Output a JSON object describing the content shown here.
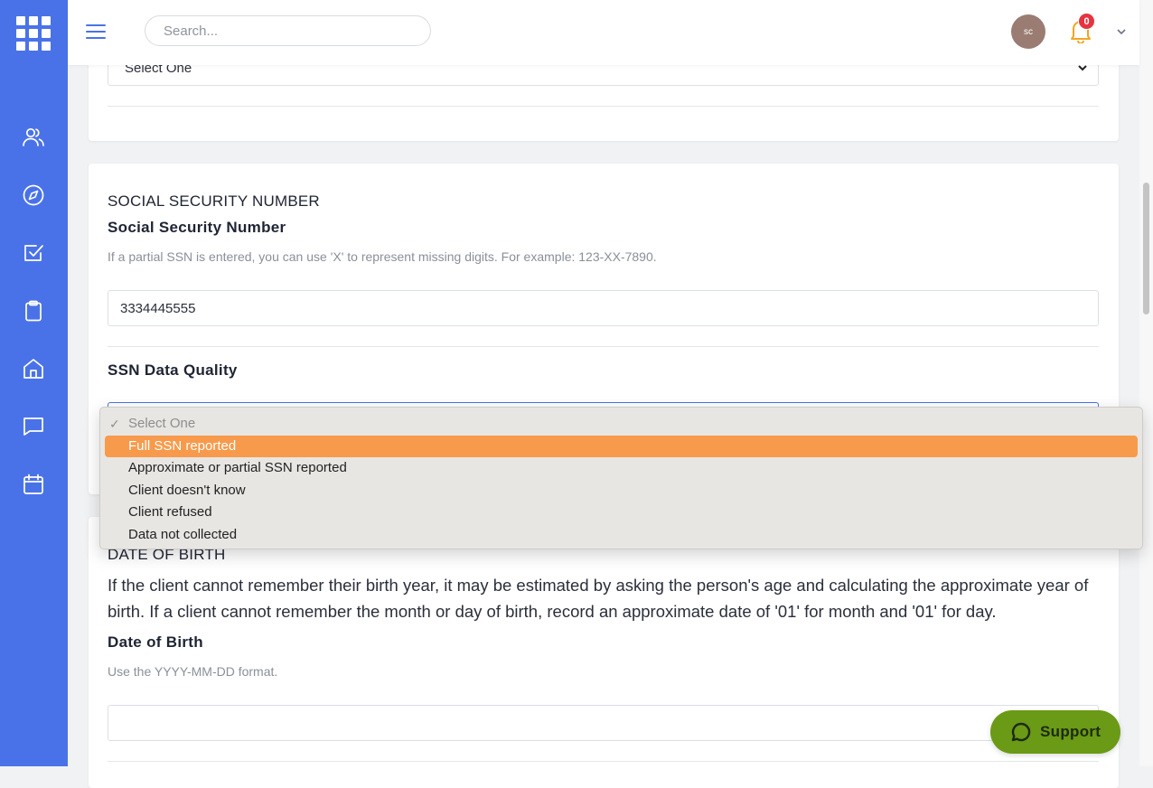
{
  "topbar": {
    "search_placeholder": "Search...",
    "avatar_initials": "sc",
    "notification_count": "0"
  },
  "card_top": {
    "select_value": "Select One"
  },
  "ssn_section": {
    "section_title": "SOCIAL SECURITY NUMBER",
    "field_label": "Social Security Number",
    "help_text": "If a partial SSN is entered, you can use 'X' to represent missing digits. For example: 123-XX-7890.",
    "input_value": "3334445555",
    "quality_label": "SSN Data Quality"
  },
  "dropdown": {
    "options": [
      {
        "label": "Select One",
        "state": "disabled-checked"
      },
      {
        "label": "Full SSN reported",
        "state": "highlighted"
      },
      {
        "label": "Approximate or partial SSN reported",
        "state": "normal"
      },
      {
        "label": "Client doesn't know",
        "state": "normal"
      },
      {
        "label": "Client refused",
        "state": "normal"
      },
      {
        "label": "Data not collected",
        "state": "normal"
      }
    ]
  },
  "dob_section": {
    "section_title": "DATE OF BIRTH",
    "paragraph": "If the client cannot remember their birth year, it may be estimated by asking the person's age and calculating the approximate year of birth. If a client cannot remember the month or day of birth, record an approximate date of '01' for month and '01' for day.",
    "field_label": "Date of Birth",
    "help_text": "Use the YYYY-MM-DD format.",
    "input_value": ""
  },
  "support": {
    "label": "Support"
  },
  "colors": {
    "sidebar": "#4a72e8",
    "highlight": "#f79a4b",
    "support": "#6a9a16",
    "badge": "#e53340"
  },
  "icons": [
    "apps-grid-icon",
    "users-icon",
    "compass-icon",
    "checkbox-icon",
    "clipboard-icon",
    "home-icon",
    "chat-icon",
    "calendar-icon",
    "hamburger-icon",
    "bell-icon",
    "chevron-down-icon",
    "support-chat-icon"
  ]
}
